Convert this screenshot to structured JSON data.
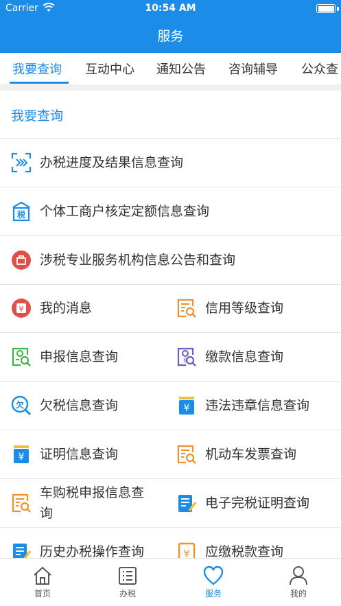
{
  "status_bar": {
    "carrier": "Carrier",
    "time": "10:54 AM"
  },
  "header": {
    "title": "服务"
  },
  "tabs": [
    {
      "label": "我要查询"
    },
    {
      "label": "互动中心"
    },
    {
      "label": "通知公告"
    },
    {
      "label": "咨询辅导"
    },
    {
      "label": "公众查"
    }
  ],
  "section": {
    "title": "我要查询"
  },
  "full_rows": [
    {
      "label": "办税进度及结果信息查询",
      "icon": "progress-scan-icon"
    },
    {
      "label": "个体工商户核定定额信息查询",
      "icon": "tax-building-icon"
    },
    {
      "label": "涉税专业服务机构信息公告和查询",
      "icon": "agency-badge-icon"
    }
  ],
  "grid_rows": [
    {
      "left": {
        "label": "我的消息",
        "icon": "message-yen-icon"
      },
      "right": {
        "label": "信用等级查询",
        "icon": "credit-search-icon"
      }
    },
    {
      "left": {
        "label": "申报信息查询",
        "icon": "declare-search-icon"
      },
      "right": {
        "label": "缴款信息查询",
        "icon": "payment-search-icon"
      }
    },
    {
      "left": {
        "label": "欠税信息查询",
        "icon": "arrears-search-icon"
      },
      "right": {
        "label": "违法违章信息查询",
        "icon": "violation-yen-icon"
      }
    },
    {
      "left": {
        "label": "证明信息查询",
        "icon": "certificate-yen-icon"
      },
      "right": {
        "label": "机动车发票查询",
        "icon": "vehicle-invoice-icon"
      }
    },
    {
      "left": {
        "label": "车购税申报信息查询",
        "icon": "car-tax-search-icon"
      },
      "right": {
        "label": "电子完税证明查询",
        "icon": "e-certificate-icon"
      }
    },
    {
      "left": {
        "label": "历史办税操作查询",
        "icon": "history-edit-icon"
      },
      "right": {
        "label": "应缴税款查询",
        "icon": "due-tax-yen-icon"
      }
    }
  ],
  "tabbar": [
    {
      "label": "首页",
      "icon": "home-icon"
    },
    {
      "label": "办税",
      "icon": "list-icon"
    },
    {
      "label": "服务",
      "icon": "heart-icon"
    },
    {
      "label": "我的",
      "icon": "person-icon"
    }
  ],
  "colors": {
    "primary": "#1b8ce8",
    "orange": "#f0912e",
    "green": "#3db54a",
    "red": "#e0504b",
    "purple": "#6a5bc7"
  }
}
